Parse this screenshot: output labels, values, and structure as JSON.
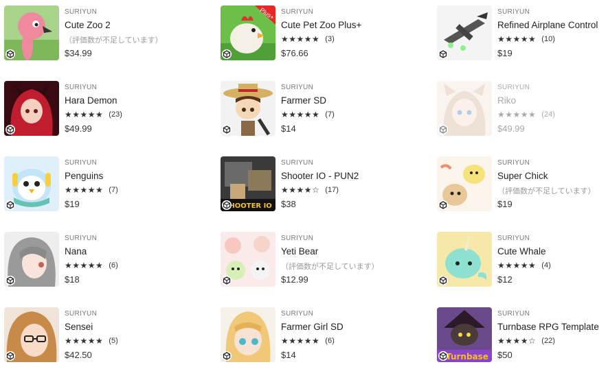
{
  "assets": [
    {
      "publisher": "SURIYUN",
      "title": "Cute Zoo 2",
      "rating": "",
      "no_rating": "（評価数が不足しています）",
      "price": "$34.99",
      "thumb_icon": "flamingo"
    },
    {
      "publisher": "SURIYUN",
      "title": "Cute Pet Zoo Plus+",
      "rating": "★★★★★",
      "count": "(3)",
      "price": "$76.66",
      "thumb_icon": "rooster",
      "badge": "Plus+"
    },
    {
      "publisher": "SURIYUN",
      "title": "Refined Airplane Control",
      "rating": "★★★★★",
      "count": "(10)",
      "price": "$19",
      "thumb_icon": "airplane"
    },
    {
      "publisher": "SURIYUN",
      "title": "Hara Demon",
      "rating": "★★★★★",
      "count": "(23)",
      "price": "$49.99",
      "thumb_icon": "demon-girl"
    },
    {
      "publisher": "SURIYUN",
      "title": "Farmer SD",
      "rating": "★★★★★",
      "count": "(7)",
      "price": "$14",
      "thumb_icon": "farmer"
    },
    {
      "publisher": "SURIYUN",
      "title": "Riko",
      "rating": "★★★★★",
      "count": "(24)",
      "price": "$49.99",
      "thumb_icon": "cat-girl",
      "disabled": true
    },
    {
      "publisher": "SURIYUN",
      "title": "Penguins",
      "rating": "★★★★★",
      "count": "(7)",
      "price": "$19",
      "thumb_icon": "penguin"
    },
    {
      "publisher": "SURIYUN",
      "title": "Shooter IO - PUN2",
      "rating": "★★★★☆",
      "count": "(17)",
      "price": "$38",
      "thumb_icon": "shooter",
      "badge": "SHOOTER IO"
    },
    {
      "publisher": "SURIYUN",
      "title": "Super Chick",
      "rating": "",
      "no_rating": "（評価数が不足しています）",
      "price": "$19",
      "thumb_icon": "chick"
    },
    {
      "publisher": "SURIYUN",
      "title": "Nana",
      "rating": "★★★★★",
      "count": "(6)",
      "price": "$18",
      "thumb_icon": "nana"
    },
    {
      "publisher": "SURIYUN",
      "title": "Yeti Bear",
      "rating": "",
      "no_rating": "（評価数が不足しています）",
      "price": "$12.99",
      "thumb_icon": "yeti"
    },
    {
      "publisher": "SURIYUN",
      "title": "Cute Whale",
      "rating": "★★★★★",
      "count": "(4)",
      "price": "$12",
      "thumb_icon": "whale"
    },
    {
      "publisher": "SURIYUN",
      "title": "Sensei",
      "rating": "★★★★★",
      "count": "(5)",
      "price": "$42.50",
      "thumb_icon": "sensei"
    },
    {
      "publisher": "SURIYUN",
      "title": "Farmer Girl SD",
      "rating": "★★★★★",
      "count": "(6)",
      "price": "$14",
      "thumb_icon": "farmer-girl"
    },
    {
      "publisher": "SURIYUN",
      "title": "Turnbase RPG Template",
      "rating": "★★★★☆",
      "count": "(22)",
      "price": "$50",
      "thumb_icon": "rpg",
      "badge": "Turnbase"
    }
  ]
}
